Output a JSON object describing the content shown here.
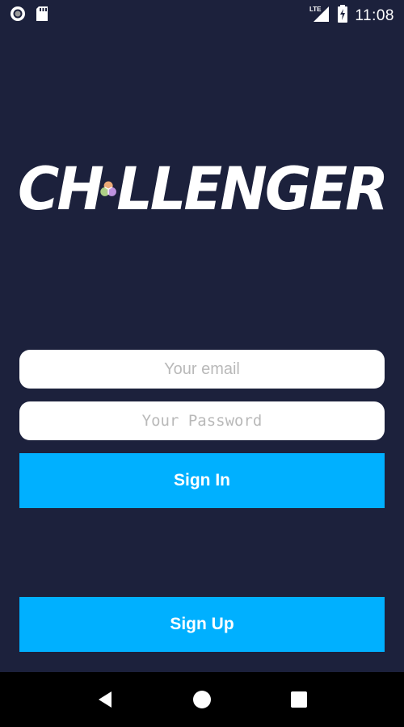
{
  "status_bar": {
    "time": "11:08",
    "network": "LTE",
    "icons": [
      "record-icon",
      "sd-card-icon",
      "signal-icon",
      "battery-charging-icon"
    ]
  },
  "logo": {
    "prefix": "CH",
    "suffix": "LLENGER",
    "circle_colors": [
      "#f8b27a",
      "#b5d98a",
      "#c79ae8"
    ]
  },
  "login_form": {
    "email_placeholder": "Your email",
    "password_placeholder": "Your Password",
    "sign_in_label": "Sign In",
    "sign_up_label": "Sign Up"
  },
  "nav_bar": {
    "icons": [
      "back-icon",
      "home-icon",
      "recents-icon"
    ]
  },
  "colors": {
    "background": "#1c213c",
    "accent": "#00b0ff",
    "field": "#ffffff"
  }
}
